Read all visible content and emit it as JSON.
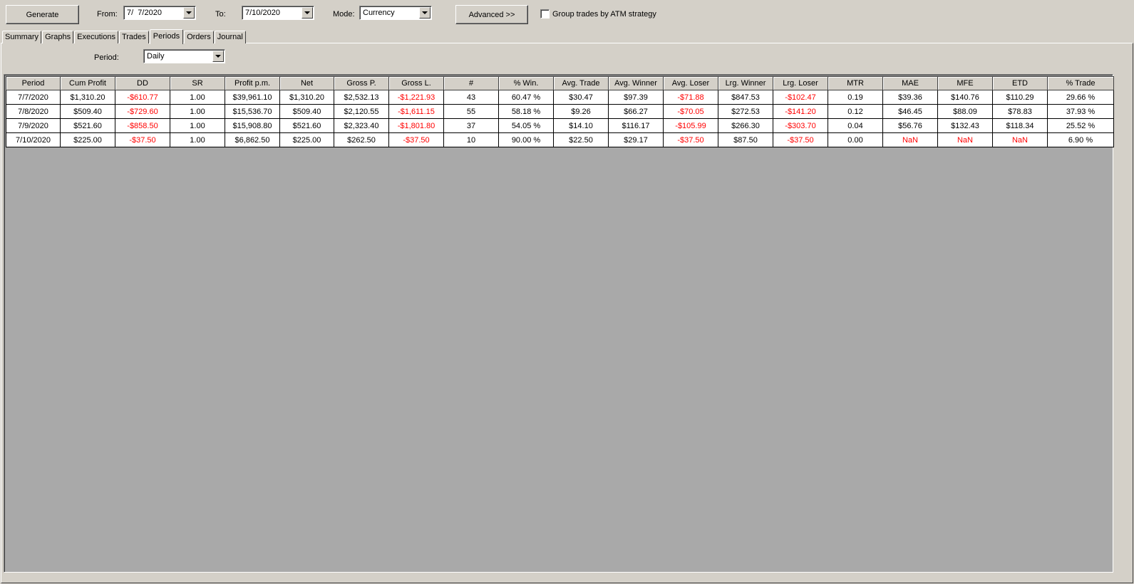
{
  "toolbar": {
    "generate_label": "Generate",
    "from_label": "From:",
    "from_value": "7/  7/2020",
    "to_label": "To:",
    "to_value": "7/10/2020",
    "mode_label": "Mode:",
    "mode_value": "Currency",
    "advanced_label": "Advanced >>",
    "group_label": "Group trades by ATM strategy",
    "group_checked": false
  },
  "tabs": [
    {
      "label": "Summary"
    },
    {
      "label": "Graphs"
    },
    {
      "label": "Executions"
    },
    {
      "label": "Trades"
    },
    {
      "label": "Periods",
      "active": true
    },
    {
      "label": "Orders"
    },
    {
      "label": "Journal"
    }
  ],
  "period": {
    "label": "Period:",
    "value": "Daily"
  },
  "grid": {
    "columns": [
      "Period",
      "Cum Profit",
      "DD",
      "SR",
      "Profit p.m.",
      "Net",
      "Gross P.",
      "Gross L.",
      "#",
      "% Win.",
      "Avg. Trade",
      "Avg. Winner",
      "Avg. Loser",
      "Lrg. Winner",
      "Lrg. Loser",
      "MTR",
      "MAE",
      "MFE",
      "ETD",
      "% Trade"
    ],
    "rows": [
      [
        "7/7/2020",
        "$1,310.20",
        "-$610.77",
        "1.00",
        "$39,961.10",
        "$1,310.20",
        "$2,532.13",
        "-$1,221.93",
        "43",
        "60.47 %",
        "$30.47",
        "$97.39",
        "-$71.88",
        "$847.53",
        "-$102.47",
        "0.19",
        "$39.36",
        "$140.76",
        "$110.29",
        "29.66 %"
      ],
      [
        "7/8/2020",
        "$509.40",
        "-$729.60",
        "1.00",
        "$15,536.70",
        "$509.40",
        "$2,120.55",
        "-$1,611.15",
        "55",
        "58.18 %",
        "$9.26",
        "$66.27",
        "-$70.05",
        "$272.53",
        "-$141.20",
        "0.12",
        "$46.45",
        "$88.09",
        "$78.83",
        "37.93 %"
      ],
      [
        "7/9/2020",
        "$521.60",
        "-$858.50",
        "1.00",
        "$15,908.80",
        "$521.60",
        "$2,323.40",
        "-$1,801.80",
        "37",
        "54.05 %",
        "$14.10",
        "$116.17",
        "-$105.99",
        "$266.30",
        "-$303.70",
        "0.04",
        "$56.76",
        "$132.43",
        "$118.34",
        "25.52 %"
      ],
      [
        "7/10/2020",
        "$225.00",
        "-$37.50",
        "1.00",
        "$6,862.50",
        "$225.00",
        "$262.50",
        "-$37.50",
        "10",
        "90.00 %",
        "$22.50",
        "$29.17",
        "-$37.50",
        "$87.50",
        "-$37.50",
        "0.00",
        "NaN",
        "NaN",
        "NaN",
        "6.90 %"
      ]
    ],
    "negative_color": "#ff0000"
  }
}
